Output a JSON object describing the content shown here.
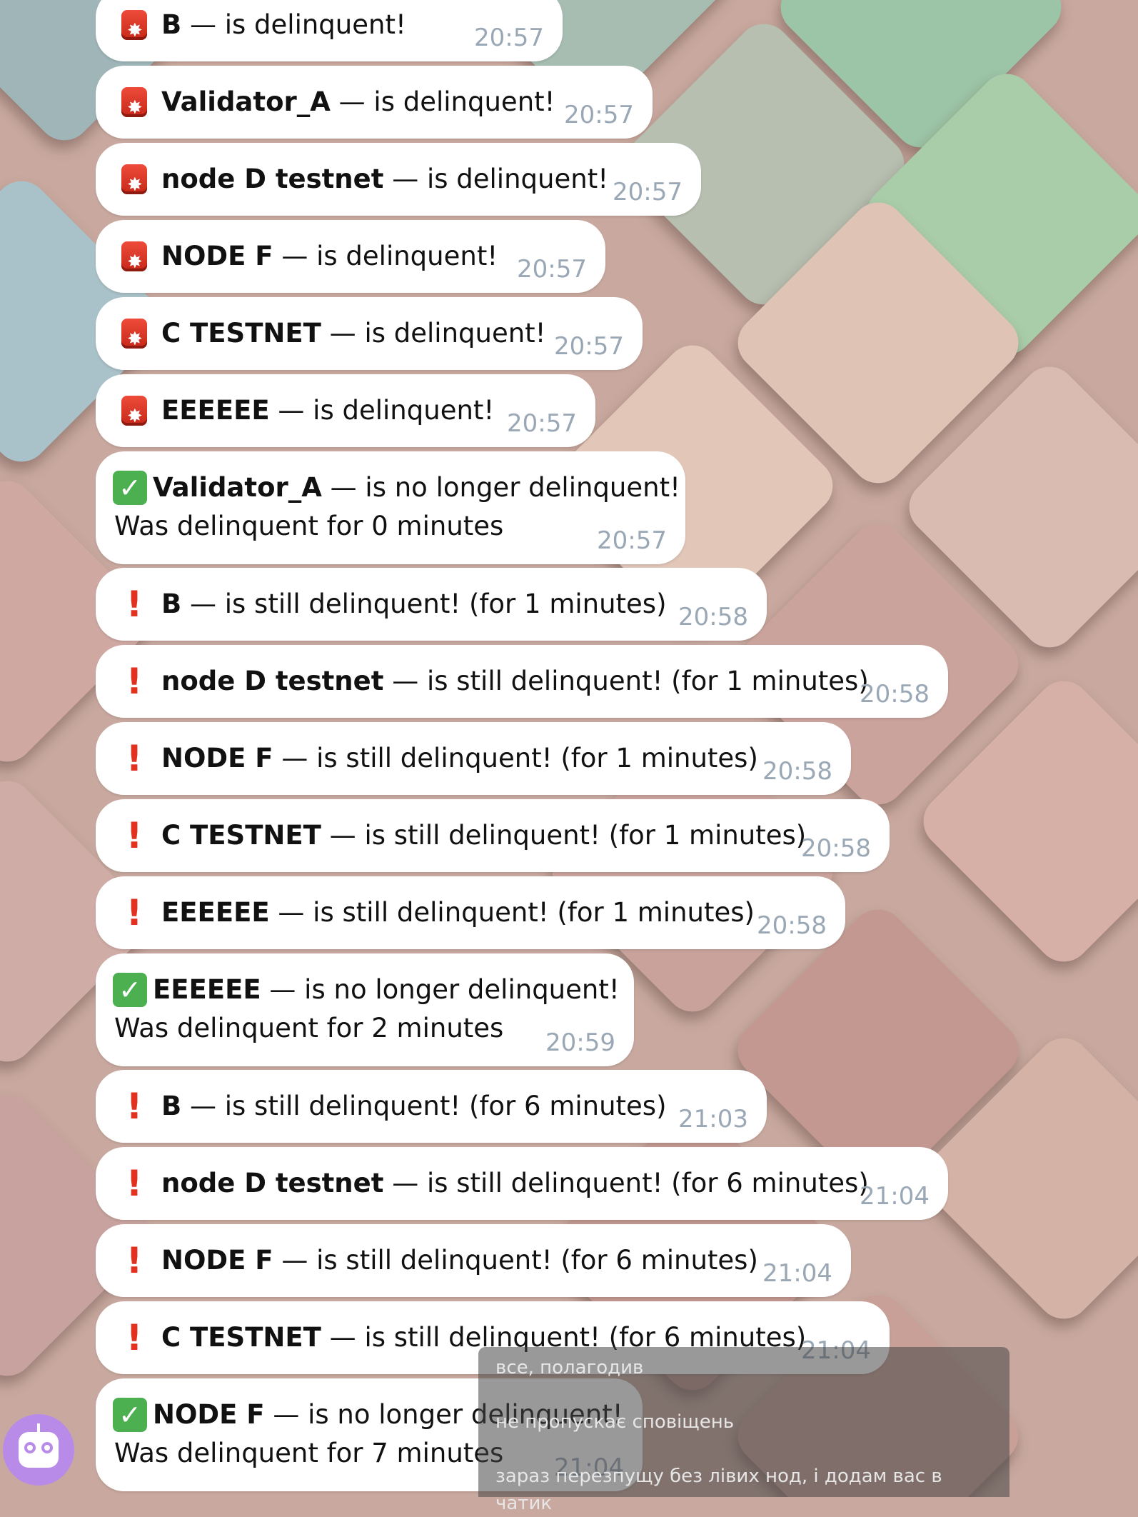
{
  "messages": [
    {
      "type": "alarm",
      "name": "B",
      "text": " — is delinquent!",
      "time": "20:57"
    },
    {
      "type": "alarm",
      "name": "Validator_A",
      "text": " — is delinquent!",
      "time": "20:57"
    },
    {
      "type": "alarm",
      "name": "node D testnet",
      "text": " — is delinquent!",
      "time": "20:57"
    },
    {
      "type": "alarm",
      "name": "NODE F",
      "text": " — is delinquent!",
      "time": "20:57"
    },
    {
      "type": "alarm",
      "name": "C TESTNET",
      "text": " — is delinquent!",
      "time": "20:57"
    },
    {
      "type": "alarm",
      "name": "EEEEEE",
      "text": " — is delinquent!",
      "time": "20:57"
    },
    {
      "type": "check",
      "name": "Validator_A",
      "text": " — is no longer delinquent!",
      "sub": "Was delinquent for 0 minutes",
      "time": "20:57"
    },
    {
      "type": "excl",
      "name": "B",
      "text": " — is still delinquent! (for 1 minutes)",
      "time": "20:58"
    },
    {
      "type": "excl",
      "name": "node D testnet",
      "text": " — is still delinquent! (for 1 minutes)",
      "time": "20:58"
    },
    {
      "type": "excl",
      "name": "NODE F",
      "text": " — is still delinquent! (for 1 minutes)",
      "time": "20:58"
    },
    {
      "type": "excl",
      "name": "C TESTNET",
      "text": " — is still delinquent! (for 1 minutes)",
      "time": "20:58"
    },
    {
      "type": "excl",
      "name": "EEEEEE",
      "text": " — is still delinquent! (for 1 minutes)",
      "time": "20:58"
    },
    {
      "type": "check",
      "name": "EEEEEE",
      "text": " — is no longer delinquent!",
      "sub": "Was delinquent for 2 minutes",
      "time": "20:59"
    },
    {
      "type": "excl",
      "name": "B",
      "text": " — is still delinquent! (for 6 minutes)",
      "time": "21:03"
    },
    {
      "type": "excl",
      "name": "node D testnet",
      "text": " — is still delinquent! (for 6 minutes)",
      "time": "21:04"
    },
    {
      "type": "excl",
      "name": "NODE F",
      "text": " — is still delinquent! (for 6 minutes)",
      "time": "21:04"
    },
    {
      "type": "excl",
      "name": "C TESTNET",
      "text": " — is still delinquent! (for 6 minutes)",
      "time": "21:04"
    },
    {
      "type": "check",
      "name": "NODE F",
      "text": " — is no longer delinquent!",
      "sub": "Was delinquent for 7 minutes",
      "time": "21:04"
    }
  ],
  "caption": {
    "lines": [
      "все, полагодив",
      "не пропускає сповіщень",
      "зараз перезпущу без лівих нод, і додам вас в чатик"
    ]
  },
  "icons": {
    "alarm": "alarm-light-icon",
    "check": "check-mark-icon",
    "excl": "exclamation-icon",
    "avatar": "robot-avatar-icon"
  },
  "colors": {
    "bubble": "#ffffff",
    "time": "#9aa7b5",
    "exclamation": "#e0321f",
    "check": "#4caf50",
    "avatar": "#b98be9"
  }
}
